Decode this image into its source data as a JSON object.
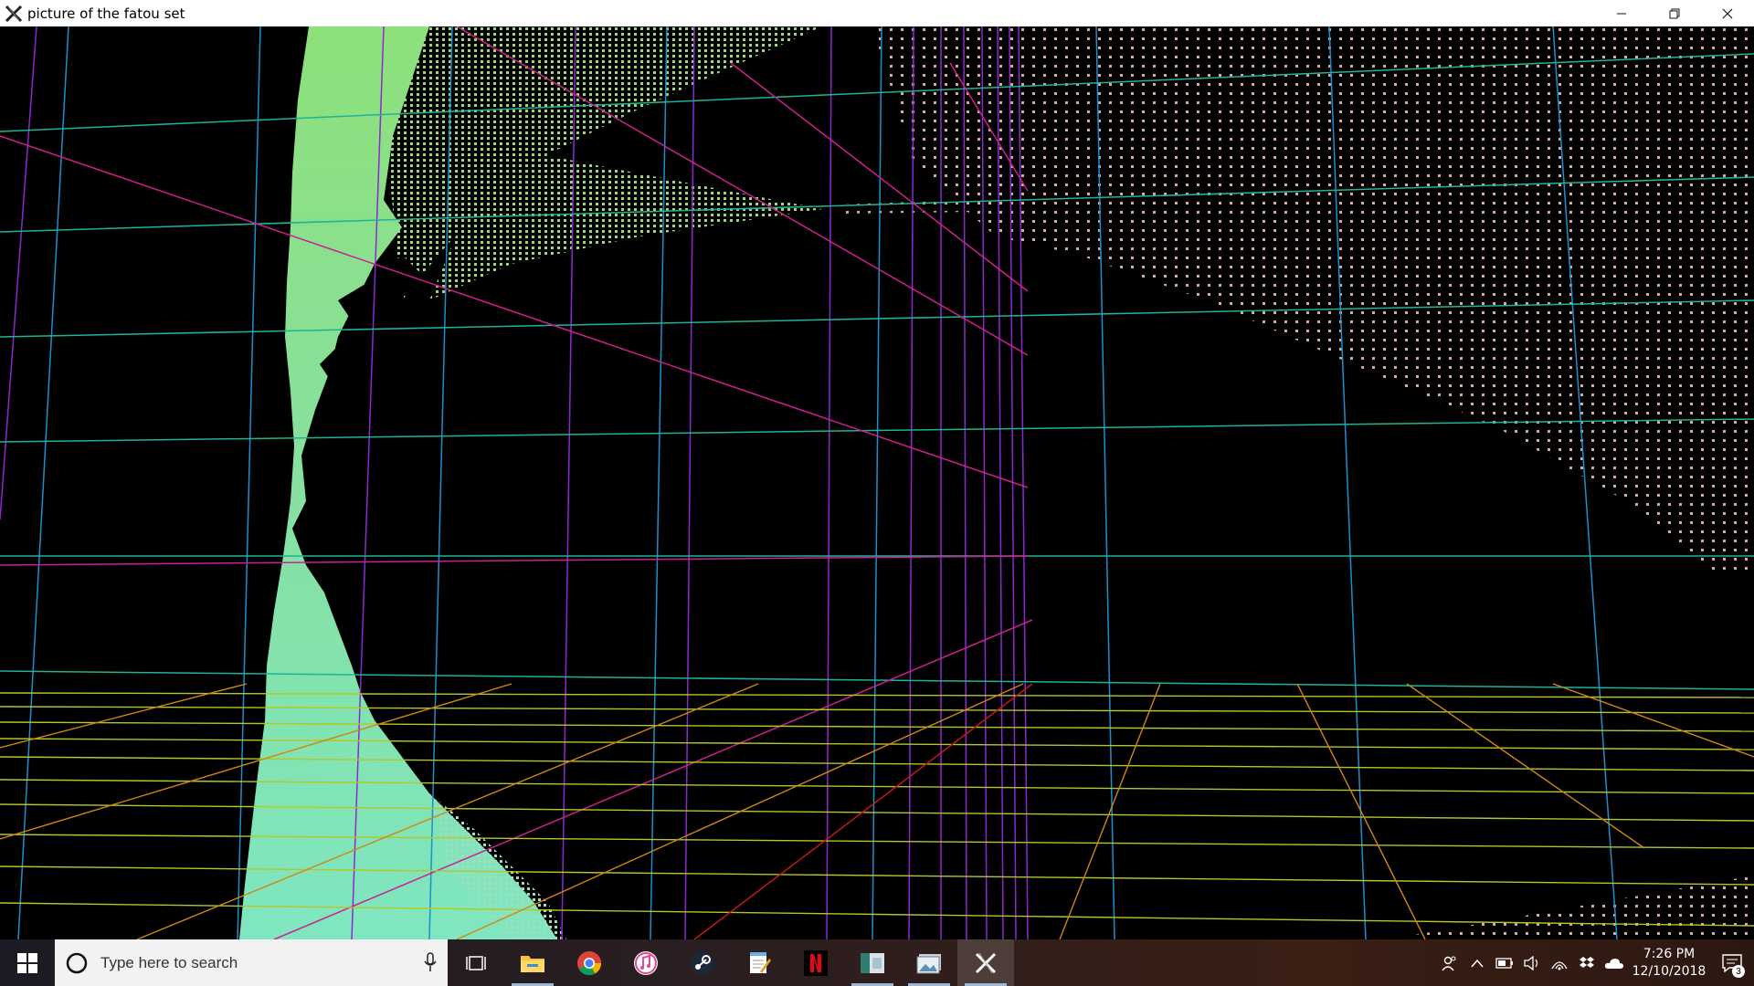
{
  "window": {
    "title": "picture of the fatou set",
    "app_icon": "x-app-icon",
    "controls": [
      "minimize-icon",
      "restore-icon",
      "close-icon"
    ]
  },
  "taskbar": {
    "start_icon": "windows-start-icon",
    "search_placeholder": "Type here to search",
    "mic_icon": "microphone-icon",
    "apps": [
      {
        "name": "task-view-icon"
      },
      {
        "name": "file-explorer-icon"
      },
      {
        "name": "chrome-icon"
      },
      {
        "name": "itunes-icon"
      },
      {
        "name": "steam-icon"
      },
      {
        "name": "notepad-icon"
      },
      {
        "name": "netflix-icon"
      },
      {
        "name": "app-window-icon"
      },
      {
        "name": "photos-icon"
      },
      {
        "name": "x-app-icon",
        "active": true
      }
    ],
    "tray": {
      "icons": [
        "people-icon",
        "chevron-up-icon",
        "battery-icon",
        "volume-icon",
        "wifi-icon",
        "dropbox-icon",
        "onedrive-icon"
      ],
      "time": "7:26 PM",
      "date": "12/10/2018",
      "notification_count": "3"
    }
  },
  "colors": {
    "grid_blue": "#1e90c8",
    "grid_teal": "#20b5a0",
    "grid_purple": "#9b30d0",
    "grid_magenta": "#d0208c",
    "floor_orange": "#d08a10",
    "floor_yellow": "#b8c830",
    "fractal_green": "#8fe080",
    "dots_pink": "#d4a89a"
  }
}
